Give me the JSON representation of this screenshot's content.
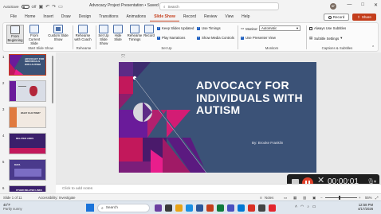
{
  "titlebar": {
    "autosave_label": "AutoSave",
    "autosave_state": "Off",
    "doc_title": "Advocacy Project Presentation • Saved",
    "search_placeholder": "Search",
    "avatar_initials": "BF"
  },
  "menu": {
    "items": [
      "File",
      "Home",
      "Insert",
      "Draw",
      "Design",
      "Transitions",
      "Animations",
      "Slide Show",
      "Record",
      "Review",
      "View",
      "Help"
    ],
    "active": "Slide Show",
    "record_label": "Record",
    "share_label": "Share"
  },
  "ribbon": {
    "from_beginning": "From Beginning",
    "from_current": "From Current Slide",
    "custom_show": "Custom Slide Show",
    "group_start": "Start Slide Show",
    "rehearse_coach": "Rehearse with Coach",
    "group_rehearse": "Rehearse",
    "set_up": "Set Up Slide Show",
    "hide_slide": "Hide Slide",
    "rehearse_timings": "Rehearse Timings",
    "record": "Record",
    "keep_updated": "Keep Slides Updated",
    "play_narrations": "Play Narrations",
    "use_timings": "Use Timings",
    "show_media": "Show Media Controls",
    "group_setup": "Set Up",
    "monitor_label": "Monitor:",
    "monitor_value": "Automatic",
    "presenter_view": "Use Presenter View",
    "group_monitors": "Monitors",
    "always_subtitles": "Always Use Subtitles",
    "subtitle_settings": "Subtitle Settings",
    "group_captions": "Captions & Subtitles"
  },
  "slide": {
    "title": "ADVOCACY FOR INDIVIDUALS WITH AUTISM",
    "author": "By: Brooke Franklin",
    "colors": {
      "background": "#3b5277",
      "magenta": "#c2185b",
      "purple": "#6a1b9a",
      "pink": "#e91e8c"
    }
  },
  "thumbnails": [
    {
      "num": "1",
      "label": "ADVOCACY FOR INDIVIDUALS WITH AUTISM"
    },
    {
      "num": "2",
      "label": ""
    },
    {
      "num": "3",
      "label": "WHAT IS AUTISM?"
    },
    {
      "num": "4",
      "label": "RELATED LINKS"
    },
    {
      "num": "5",
      "label": "DATA"
    },
    {
      "num": "6",
      "label": "OTHER RELATED LINKS"
    }
  ],
  "notes": {
    "placeholder": "Click to add notes"
  },
  "status": {
    "slide_count": "Slide 1 of 11",
    "accessibility": "Accessibility: Investigate",
    "notes_btn": "Notes",
    "zoom": "55%"
  },
  "recorder": {
    "time": "00:00:01"
  },
  "taskbar": {
    "temp": "40°F",
    "weather": "Partly sunny",
    "search": "Search",
    "time": "12:58 PM",
    "date": "4/17/2026"
  }
}
